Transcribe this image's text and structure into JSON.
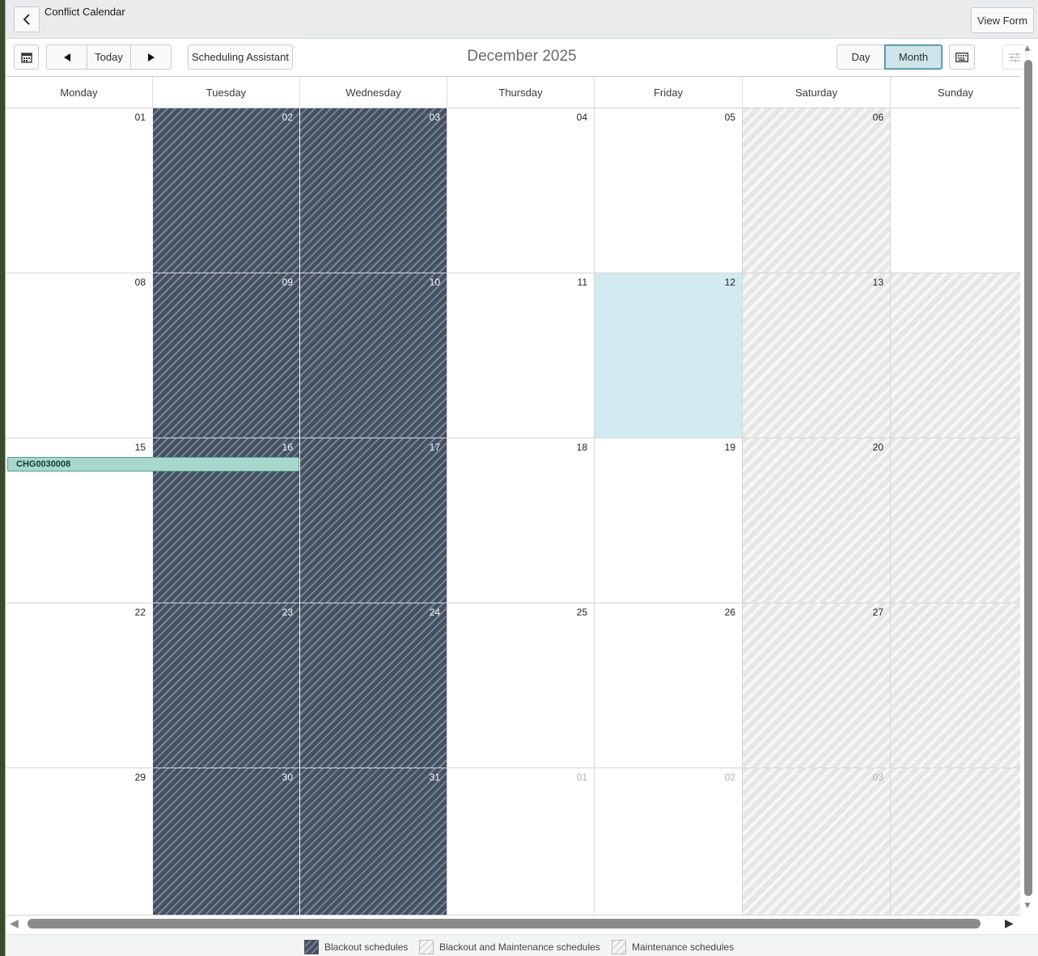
{
  "header": {
    "title": "Conflict Calendar",
    "view_form_label": "View Form"
  },
  "toolbar": {
    "today_label": "Today",
    "scheduling_assistant_label": "Scheduling Assistant",
    "month_title": "December 2025",
    "day_label": "Day",
    "month_label": "Month",
    "active_view": "Month"
  },
  "calendar": {
    "weekdays": [
      "Monday",
      "Tuesday",
      "Wednesday",
      "Thursday",
      "Friday",
      "Saturday",
      "Sunday"
    ],
    "weeks": [
      [
        {
          "d": "01",
          "t": "normal"
        },
        {
          "d": "02",
          "t": "blackout"
        },
        {
          "d": "03",
          "t": "blackout"
        },
        {
          "d": "04",
          "t": "normal"
        },
        {
          "d": "05",
          "t": "normal"
        },
        {
          "d": "06",
          "t": "maint"
        },
        {
          "d": "",
          "t": "normal"
        }
      ],
      [
        {
          "d": "08",
          "t": "normal"
        },
        {
          "d": "09",
          "t": "blackout"
        },
        {
          "d": "10",
          "t": "blackout"
        },
        {
          "d": "11",
          "t": "normal"
        },
        {
          "d": "12",
          "t": "today"
        },
        {
          "d": "13",
          "t": "maint"
        },
        {
          "d": "",
          "t": "maint"
        }
      ],
      [
        {
          "d": "15",
          "t": "normal"
        },
        {
          "d": "16",
          "t": "blackout"
        },
        {
          "d": "17",
          "t": "blackout"
        },
        {
          "d": "18",
          "t": "normal"
        },
        {
          "d": "19",
          "t": "normal"
        },
        {
          "d": "20",
          "t": "maint"
        },
        {
          "d": "",
          "t": "maint"
        }
      ],
      [
        {
          "d": "22",
          "t": "normal"
        },
        {
          "d": "23",
          "t": "blackout"
        },
        {
          "d": "24",
          "t": "blackout"
        },
        {
          "d": "25",
          "t": "normal"
        },
        {
          "d": "26",
          "t": "normal"
        },
        {
          "d": "27",
          "t": "maint"
        },
        {
          "d": "",
          "t": "maint"
        }
      ],
      [
        {
          "d": "29",
          "t": "normal"
        },
        {
          "d": "30",
          "t": "blackout"
        },
        {
          "d": "31",
          "t": "blackout"
        },
        {
          "d": "01",
          "t": "other"
        },
        {
          "d": "02",
          "t": "other"
        },
        {
          "d": "03",
          "t": "maint-other"
        },
        {
          "d": "",
          "t": "maint"
        }
      ]
    ],
    "event": {
      "label": "CHG0030008"
    }
  },
  "legend": {
    "blackout": "Blackout schedules",
    "blackout_and_maintenance": "Blackout and Maintenance schedules",
    "maintenance": "Maintenance schedules"
  },
  "colors": {
    "blackout": "#445163",
    "today": "#d1eaf0",
    "event": "#a6d9cc",
    "active_view": "#cfe4ea"
  },
  "icons": {
    "back": "chevron-left-icon",
    "calendar_picker": "calendar-icon",
    "prev": "triangle-left-icon",
    "next": "triangle-right-icon",
    "keyboard": "keyboard-icon",
    "settings": "sliders-icon"
  }
}
